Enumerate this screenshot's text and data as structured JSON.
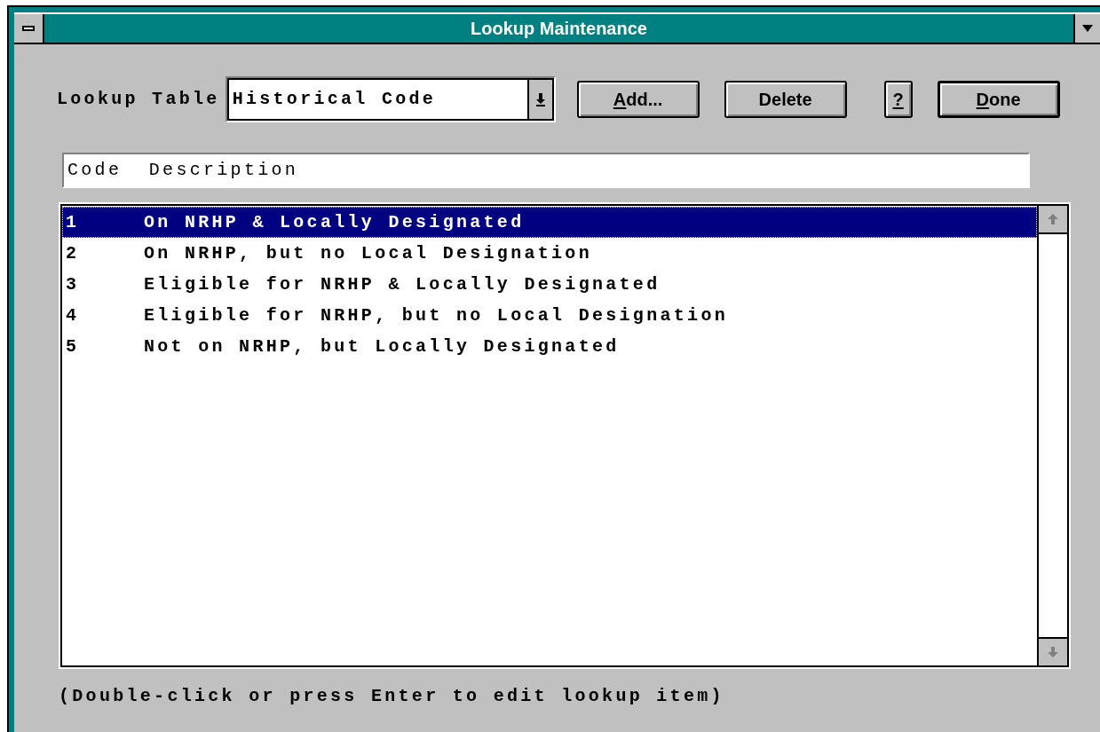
{
  "window": {
    "title": "Lookup Maintenance"
  },
  "lookup_table": {
    "label": "Lookup Table",
    "value": "Historical Code"
  },
  "buttons": [
    {
      "label": "Add...",
      "mnemonic": true,
      "default": false,
      "kind": "wide"
    },
    {
      "label": "Delete",
      "mnemonic": false,
      "default": false,
      "kind": "wide"
    },
    {
      "label": "?",
      "mnemonic": true,
      "default": false,
      "kind": "narrow"
    },
    {
      "label": "Done",
      "mnemonic": true,
      "default": true,
      "kind": "wide"
    }
  ],
  "list": {
    "header": "Code  Description",
    "rows": [
      {
        "code": "1",
        "description": "On NRHP & Locally Designated",
        "selected": true
      },
      {
        "code": "2",
        "description": "On NRHP, but no Local Designation",
        "selected": false
      },
      {
        "code": "3",
        "description": "Eligible for NRHP & Locally Designated",
        "selected": false
      },
      {
        "code": "4",
        "description": "Eligible for NRHP, but no Local Designation",
        "selected": false
      },
      {
        "code": "5",
        "description": "Not on NRHP, but Locally Designated",
        "selected": false
      }
    ]
  },
  "hint": "(Double-click or press Enter to edit lookup item)"
}
